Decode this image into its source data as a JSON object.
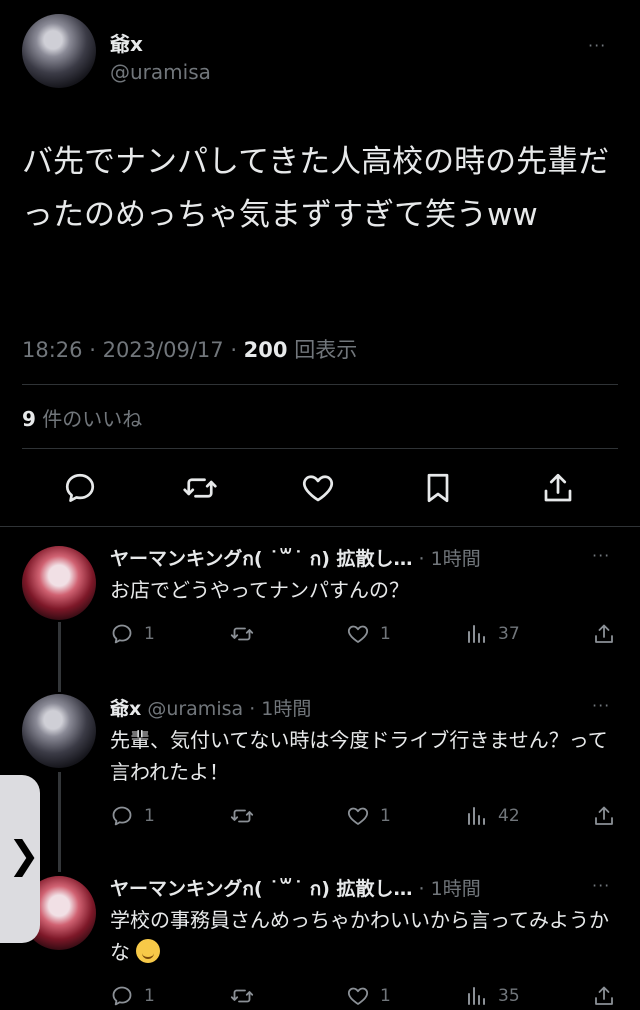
{
  "tweet": {
    "author_name": "爺x",
    "author_handle": "@uramisa",
    "text": "バ先でナンパしてきた人高校の時の先輩だったのめっちゃ気まずすぎて笑うww",
    "time": "18:26",
    "date": "2023/09/17",
    "views_count": "200",
    "views_label": "回表示",
    "likes_count": "9",
    "likes_label": "件のいいね",
    "more": "···"
  },
  "replies": [
    {
      "name": "ヤーマンキングก( ˙꒳˙ ก) 拡散し…",
      "time": "1時間",
      "text": "お店でどうやってナンパすんの？",
      "reply_count": "1",
      "like_count": "1",
      "view_count": "37"
    },
    {
      "name": "爺x",
      "handle": "@uramisa",
      "time": "1時間",
      "text": "先輩、気付いてない時は今度ドライブ行きません？って言われたよ！",
      "reply_count": "1",
      "like_count": "1",
      "view_count": "42"
    },
    {
      "name": "ヤーマンキングก( ˙꒳˙ ก) 拡散し…",
      "time": "1時間",
      "text": "学校の事務員さんめっちゃかわいいから言ってみようかな",
      "emoji": "🤤",
      "reply_count": "1",
      "like_count": "1",
      "view_count": "35"
    }
  ],
  "side_tab": {
    "label": "❯"
  },
  "icons": {
    "reply": "reply-icon",
    "retweet": "retweet-icon",
    "like": "heart-icon",
    "bookmark": "bookmark-icon",
    "share": "share-icon",
    "views": "views-icon"
  },
  "colors": {
    "background": "#000000",
    "text": "#e7e9ea",
    "secondary": "#71767b",
    "divider": "#2f3336"
  }
}
